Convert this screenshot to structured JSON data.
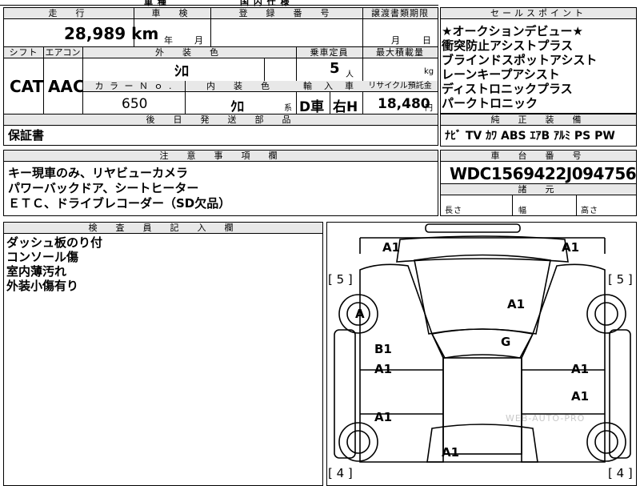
{
  "top_cut": {
    "left": "車 種",
    "mid": "国 内 仕 様"
  },
  "mileage": {
    "label": "走　行",
    "value": "28,989 km"
  },
  "inspection": {
    "label": "車　検",
    "year": "年",
    "month": "月"
  },
  "registration": {
    "label": "登　録　番　号"
  },
  "transfer": {
    "label": "譲渡書類期限",
    "month": "月",
    "day": "日"
  },
  "shift": {
    "label": "シフト",
    "value": "CAT"
  },
  "aircon": {
    "label": "エアコン",
    "value": "AAC"
  },
  "exterior_color": {
    "label": "外　装　色",
    "value": "ｼﾛ"
  },
  "capacity": {
    "label": "乗車定員",
    "value": "5",
    "unit": "人"
  },
  "max_load": {
    "label": "最大積載量",
    "unit": "kg"
  },
  "color_no": {
    "label": "カ ラ ー Ｎ ｏ .",
    "value": "650"
  },
  "interior_color": {
    "label": "内　装　色",
    "value": "ｸﾛ",
    "suffix": "系"
  },
  "import": {
    "label": "輸　入　車",
    "value1": "D車",
    "value2": "右H"
  },
  "recycle": {
    "label": "リサイクル預託金",
    "value": "18,480",
    "unit": "円"
  },
  "later_parts": {
    "label": "後　日　発　送　部　品",
    "value": "保証書"
  },
  "notes": {
    "label": "注　意　事　項　欄",
    "lines": [
      "キー現車のみ、リヤビューカメラ",
      "パワーバックドア、シートヒーター",
      "ＥＴＣ、ドライブレコーダー（SD欠品）"
    ]
  },
  "sales_points": {
    "label": "セールスポイント",
    "lines": [
      "★オークションデビュー★",
      "衝突防止アシストプラス",
      "ブラインドスポットアシスト",
      "レーンキープアシスト",
      "ディストロニックプラス",
      "パークトロニック"
    ]
  },
  "equipment": {
    "label": "純　正　装　備",
    "value": "ﾅﾋﾞ TV ｶﾜ ABS ｴｱB ｱﾙﾐ PS PW"
  },
  "chassis": {
    "label": "車　台　番　号",
    "value": "WDC1569422J094756"
  },
  "dimensions": {
    "label": "諸　元",
    "length": "長さ",
    "width": "幅",
    "height": "高さ"
  },
  "inspector": {
    "label": "検　査　員　記　入　欄",
    "lines": [
      "ダッシュ板のり付",
      "コンソール傷",
      "室内薄汚れ",
      "外装小傷有り"
    ]
  },
  "diagram": {
    "marks": [
      "A1",
      "A1",
      "A1",
      "A",
      "G",
      "B1",
      "A1",
      "A1",
      "A1",
      "A1",
      "A1"
    ],
    "tire_left_top": "[ 5 ]",
    "tire_right_top": "[ 5 ]",
    "tire_left_bottom": "[ 4 ]",
    "tire_right_bottom": "[ 4 ]",
    "watermark": "WEB-AUTO-PRO"
  }
}
